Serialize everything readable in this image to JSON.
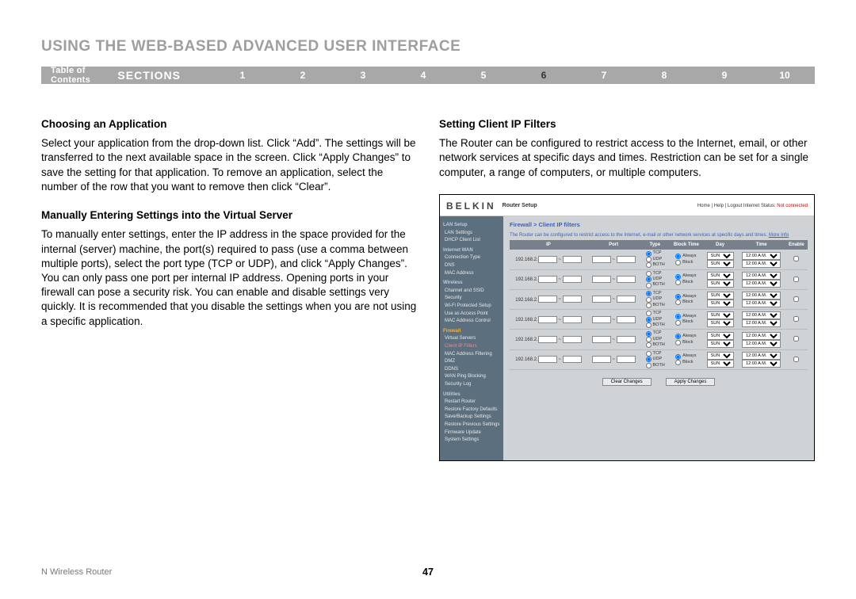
{
  "page_title": "USING THE WEB-BASED ADVANCED USER INTERFACE",
  "nav": {
    "toc": "Table of Contents",
    "sections": "SECTIONS",
    "numbers": [
      "1",
      "2",
      "3",
      "4",
      "5",
      "6",
      "7",
      "8",
      "9",
      "10"
    ],
    "active": "6"
  },
  "left": {
    "h1": "Choosing an Application",
    "p1": "Select your application from the drop-down list. Click “Add”. The settings will be transferred to the next available space in the screen. Click “Apply Changes” to save the setting for that application. To remove an application, select the number of the row that you want to remove then click “Clear”.",
    "h2": "Manually Entering Settings into the Virtual Server",
    "p2": "To manually enter settings, enter the IP address in the space provided for the internal (server) machine, the port(s) required to pass (use a comma between multiple ports), select the port type (TCP or UDP), and click “Apply Changes”. You can only pass one port per internal IP address. Opening ports in your firewall can pose a security risk. You can enable and disable settings very quickly. It is recommended that you disable the settings when you are not using a specific application."
  },
  "right": {
    "h1": "Setting Client IP Filters",
    "p1": "The Router can be configured to restrict access to the Internet, email, or other network services at specific days and times. Restriction can be set for a single computer, a range of computers, or multiple computers."
  },
  "router": {
    "brand": "BELKIN",
    "setup": "Router Setup",
    "toplinks": "Home | Help | Logout   Internet Status:",
    "status": "Not connected",
    "sidebar": {
      "groups": [
        {
          "hd": "LAN Setup",
          "items": [
            "LAN Settings",
            "DHCP Client List"
          ]
        },
        {
          "hd": "Internet WAN",
          "items": [
            "Connection Type",
            "DNS",
            "MAC Address"
          ]
        },
        {
          "hd": "Wireless",
          "items": [
            "Channel and SSID",
            "Security",
            "Wi-Fi Protected Setup",
            "Use as Access Point",
            "MAC Address Control"
          ]
        },
        {
          "hd": "Firewall",
          "items": [
            "Virtual Servers",
            "Client IP Filters",
            "MAC Address Filtering",
            "DMZ",
            "DDNS",
            "WAN Ping Blocking",
            "Security Log"
          ],
          "active": true,
          "sub": "Client IP Filters"
        },
        {
          "hd": "Utilities",
          "items": [
            "Restart Router",
            "Restore Factory Defaults",
            "Save/Backup Settings",
            "Restore Previous Settings",
            "Firmware Update",
            "System Settings"
          ]
        }
      ]
    },
    "crumb": "Firewall > Client IP filters",
    "desc": "The Router can be configured to restrict access to the Internet, e-mail or other network services at specific days and times.",
    "more": "More Info",
    "headers": [
      "IP",
      "Port",
      "Type",
      "Block Time",
      "Day",
      "Time",
      "Enable"
    ],
    "ip_pre": "192.168.2.",
    "types": [
      "TCP",
      "UDP",
      "BOTH"
    ],
    "blocks": [
      "Always",
      "Block"
    ],
    "day": "SUN",
    "time": "12:00 A.M.",
    "btn_clear": "Clear Changes",
    "btn_apply": "Apply Changes",
    "row_count": 6
  },
  "footer": {
    "name": "N Wireless Router",
    "page": "47"
  }
}
